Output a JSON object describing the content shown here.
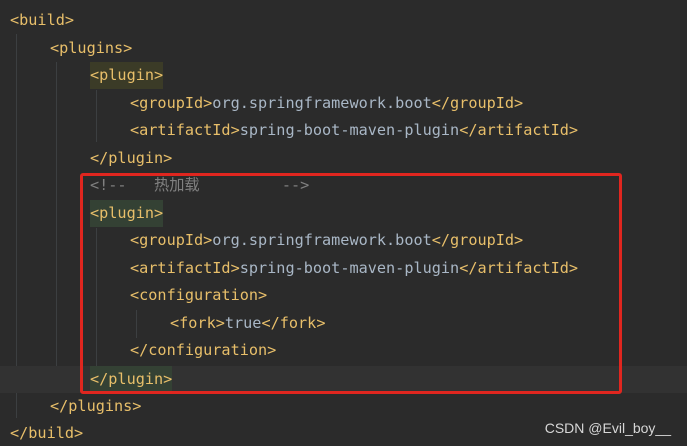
{
  "lines": {
    "l1": {
      "tag": "<build>"
    },
    "l2": {
      "tag": "<plugins>"
    },
    "l3": {
      "tag": "<plugin>"
    },
    "l4": {
      "open": "<groupId>",
      "text": "org.springframework.boot",
      "close": "</groupId>"
    },
    "l5": {
      "open": "<artifactId>",
      "text": "spring-boot-maven-plugin",
      "close": "</artifactId>"
    },
    "l6": {
      "tag": "</plugin>"
    },
    "l7": {
      "comment": "<!--   热加载         -->"
    },
    "l8": {
      "tag": "<plugin>"
    },
    "l9": {
      "open": "<groupId>",
      "text": "org.springframework.boot",
      "close": "</groupId>"
    },
    "l10": {
      "open": "<artifactId>",
      "text": "spring-boot-maven-plugin",
      "close": "</artifactId>"
    },
    "l11": {
      "tag": "<configuration>"
    },
    "l12": {
      "open": "<fork>",
      "text": "true",
      "close": "</fork>"
    },
    "l13": {
      "tag": "</configuration>"
    },
    "l14": {
      "tag": "</plugin>"
    },
    "l15": {
      "tag": "</plugins>"
    },
    "l16": {
      "tag": "</build>"
    }
  },
  "watermark": "CSDN @Evil_boy__",
  "colors": {
    "background": "#2b2b2b",
    "tag": "#e8bf6a",
    "text": "#a9b7c6",
    "comment": "#808080",
    "annotation_box": "#e0261f"
  }
}
